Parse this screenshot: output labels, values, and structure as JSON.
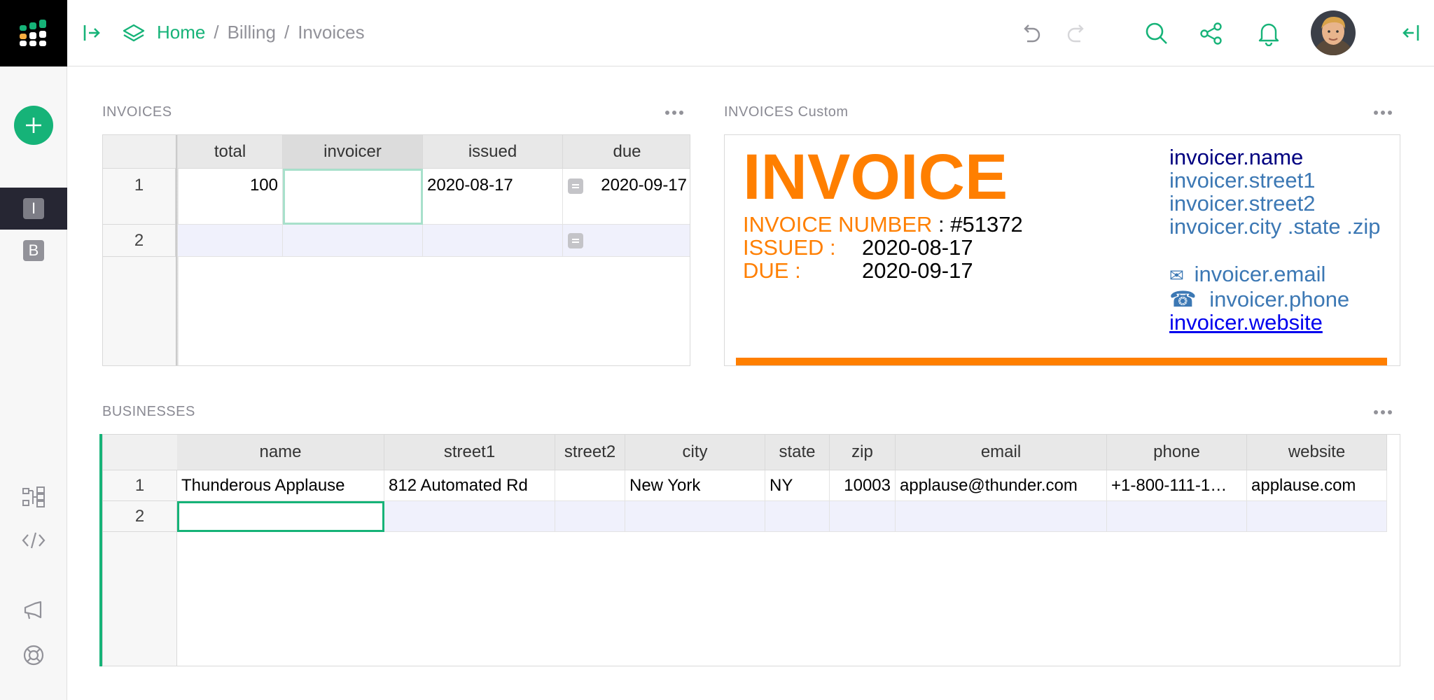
{
  "breadcrumb": {
    "home": "Home",
    "sep1": "/",
    "billing": "Billing",
    "sep2": "/",
    "invoices": "Invoices"
  },
  "pages": [
    {
      "letter": "I",
      "active": true
    },
    {
      "letter": "B",
      "active": false
    }
  ],
  "invoices_table": {
    "title": "INVOICES",
    "columns": [
      "total",
      "invoicer",
      "issued",
      "due"
    ],
    "rows": [
      {
        "num": "1",
        "total": "100",
        "invoicer": "",
        "issued": "2020-08-17",
        "due": "2020-09-17"
      },
      {
        "num": "2"
      }
    ]
  },
  "invoice_custom": {
    "title": "INVOICES Custom",
    "heading": "INVOICE",
    "number_label": "INVOICE NUMBER",
    "number_value": ": #51372",
    "issued_label": "ISSUED :",
    "issued_value": "2020-08-17",
    "due_label": "DUE :",
    "due_value": "2020-09-17",
    "invoicer_name": "invoicer.name",
    "invoicer_street1": "invoicer.street1",
    "invoicer_street2": "invoicer.street2",
    "invoicer_city": "invoicer.city .state .zip",
    "email_icon": "✉",
    "invoicer_email": "invoicer.email",
    "phone_icon": "☎",
    "invoicer_phone": "invoicer.phone",
    "invoicer_website": "invoicer.website"
  },
  "businesses_table": {
    "title": "BUSINESSES",
    "columns": [
      "name",
      "street1",
      "street2",
      "city",
      "state",
      "zip",
      "email",
      "phone",
      "website"
    ],
    "rows": [
      {
        "num": "1",
        "name": "Thunderous Applause",
        "street1": "812 Automated Rd",
        "street2": "",
        "city": "New York",
        "state": "NY",
        "zip": "10003",
        "email": "applause@thunder.com",
        "phone": "+1-800-111-1…",
        "website": "applause.com"
      },
      {
        "num": "2"
      }
    ]
  },
  "colors": {
    "accent": "#16b378",
    "invoice_orange": "#ff7f00",
    "dark": "#262633"
  }
}
